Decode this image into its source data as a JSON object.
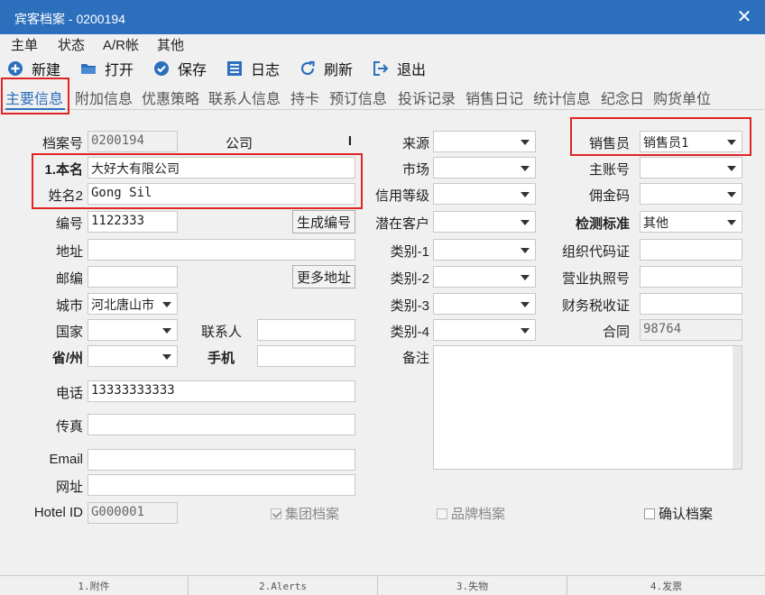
{
  "window": {
    "title": "宾客档案 - 0200194"
  },
  "menu": [
    "主单",
    "状态",
    "A/R帐",
    "其他"
  ],
  "toolbar": [
    {
      "label": "新建",
      "icon": "plus-circle-icon"
    },
    {
      "label": "打开",
      "icon": "folder-icon"
    },
    {
      "label": "保存",
      "icon": "check-circle-icon"
    },
    {
      "label": "日志",
      "icon": "list-icon"
    },
    {
      "label": "刷新",
      "icon": "refresh-icon"
    },
    {
      "label": "退出",
      "icon": "exit-icon"
    }
  ],
  "tabs": [
    "主要信息",
    "附加信息",
    "优惠策略",
    "联系人信息",
    "持卡",
    "预订信息",
    "投诉记录",
    "销售日记",
    "统计信息",
    "纪念日",
    "购货单位"
  ],
  "active_tab": "主要信息",
  "form": {
    "archive_no_label": "档案号",
    "archive_no": "0200194",
    "company_label": "公司",
    "company_marker": "I",
    "name_label": "1.本名",
    "name": "大好大有限公司",
    "name2_label": "姓名2",
    "name2": "Gong Sil",
    "code_label": "编号",
    "code": "1122333",
    "gen_code_button": "生成编号",
    "address_label": "地址",
    "address": "",
    "zip_label": "邮编",
    "zip": "",
    "more_address_button": "更多地址",
    "city_label": "城市",
    "city": "河北唐山市",
    "country_label": "国家",
    "country": "",
    "contact_label": "联系人",
    "contact": "",
    "province_label": "省/州",
    "province": "",
    "mobile_label": "手机",
    "mobile": "",
    "phone_label": "电话",
    "phone": "13333333333",
    "fax_label": "传真",
    "fax": "",
    "email_label": "Email",
    "email": "",
    "website_label": "网址",
    "website": "",
    "hotel_id_label": "Hotel ID",
    "hotel_id": "G000001",
    "source_label": "来源",
    "source": "",
    "market_label": "市场",
    "market": "",
    "credit_label": "信用等级",
    "credit": "",
    "potential_label": "潜在客户",
    "potential": "",
    "cat1_label": "类别-1",
    "cat1": "",
    "cat2_label": "类别-2",
    "cat2": "",
    "cat3_label": "类别-3",
    "cat3": "",
    "cat4_label": "类别-4",
    "cat4": "",
    "notes_label": "备注",
    "notes": "",
    "sales_label": "销售员",
    "sales": "销售员1",
    "main_account_label": "主账号",
    "main_account": "",
    "commission_label": "佣金码",
    "commission": "",
    "standard_label": "检测标准",
    "standard": "其他",
    "org_code_label": "组织代码证",
    "org_code": "",
    "license_label": "营业执照号",
    "license": "",
    "tax_label": "财务税收证",
    "tax": "",
    "contract_label": "合同",
    "contract": "98764",
    "group_archive_label": "集团档案",
    "brand_archive_label": "品牌档案",
    "confirm_archive_label": "确认档案"
  },
  "bottom_tabs": [
    "1.附件",
    "2.Alerts",
    "3.失物",
    "4.发票"
  ],
  "colors": {
    "titlebar": "#2c6fbd",
    "accent": "#2c6fbd",
    "highlight": "#e02424"
  }
}
